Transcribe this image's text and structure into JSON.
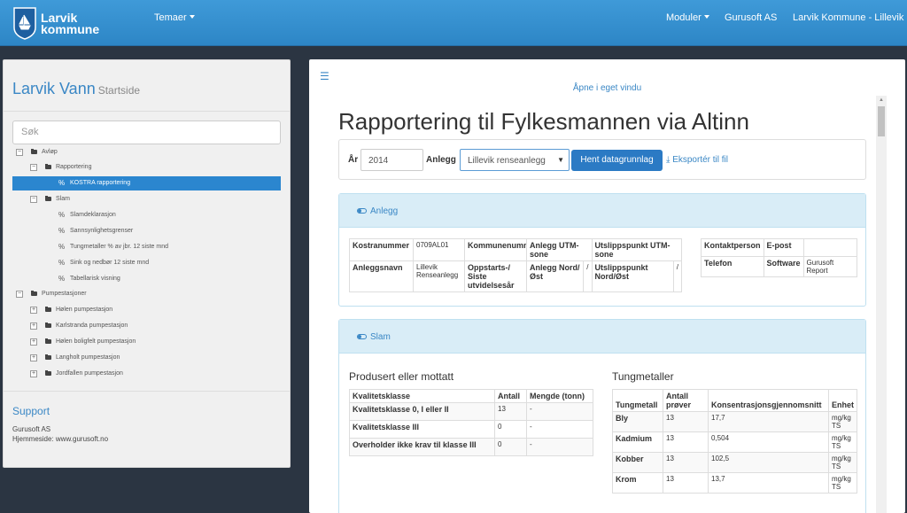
{
  "nav": {
    "logo_line1": "Larvik",
    "logo_line2": "kommune",
    "temaer": "Temaer",
    "moduler": "Moduler",
    "company": "Gurusoft AS",
    "user": "Larvik Kommune - Lillevik"
  },
  "sidebar": {
    "title": "Larvik Vann",
    "subtitle": "Startside",
    "search_placeholder": "Søk",
    "tree": [
      {
        "label": "Avløp"
      },
      {
        "label": "Rapportering"
      },
      {
        "label": "KOSTRA rapportering"
      },
      {
        "label": "Slam"
      },
      {
        "label": "Slamdeklarasjon"
      },
      {
        "label": "Sannsynlighetsgrenser"
      },
      {
        "label": "Tungmetaller % av jbr. 12 siste mnd"
      },
      {
        "label": "Sink og nedbør 12 siste mnd"
      },
      {
        "label": "Tabellarisk visning"
      },
      {
        "label": "Pumpestasjoner"
      },
      {
        "label": "Hølen pumpestasjon"
      },
      {
        "label": "Karlstranda pumpestasjon"
      },
      {
        "label": "Hølen boligfelt pumpestasjon"
      },
      {
        "label": "Langholt pumpestasjon"
      },
      {
        "label": "Jordfallen pumpestasjon"
      }
    ],
    "support_title": "Support",
    "support_company": "Gurusoft AS",
    "support_web": "Hjemmeside: www.gurusoft.no"
  },
  "main": {
    "open_window": "Åpne i eget vindu",
    "title": "Rapportering til Fylkesmannen via Altinn",
    "year_label": "År",
    "year_value": "2014",
    "plant_label": "Anlegg",
    "plant_value": "Lillevik renseanlegg",
    "fetch_button": "Hent datagrunnlag",
    "export_link": "Eksportér til fil",
    "anlegg_panel": {
      "title": "Anlegg",
      "kostranummer_label": "Kostranummer",
      "kostranummer": "0709AL01",
      "kommunenummer_label": "Kommunenummer",
      "utm_sone_label": "Anlegg UTM-sone",
      "utslipp_utm_label": "Utslippspunkt UTM-sone",
      "anleggsnavn_label": "Anleggsnavn",
      "anleggsnavn": "Lillevik Renseanlegg",
      "oppstart_label": "Oppstarts-/ Siste utvidelsesår",
      "nordost_label": "Anlegg Nord/ Øst",
      "nordost_value": "/",
      "utslipp_nordost_label": "Utslippspunkt Nord/Øst",
      "utslipp_nordost_value": "/",
      "kontakt_label": "Kontaktperson",
      "epost_label": "E-post",
      "telefon_label": "Telefon",
      "software_label": "Software",
      "software_value": "Gurusoft Report"
    },
    "slam_panel": {
      "title": "Slam",
      "produsert_title": "Produsert eller mottatt",
      "produsert_headers": [
        "Kvalitetsklasse",
        "Antall",
        "Mengde (tonn)"
      ],
      "produsert_rows": [
        [
          "Kvalitetsklasse 0, I eller II",
          "13",
          "-"
        ],
        [
          "Kvalitetsklasse III",
          "0",
          "-"
        ],
        [
          "Overholder ikke krav til klasse III",
          "0",
          "-"
        ]
      ],
      "tung_title": "Tungmetaller",
      "tung_headers": [
        "Tungmetall",
        "Antall prøver",
        "Konsentrasjonsgjennomsnitt",
        "Enhet"
      ],
      "tung_rows": [
        [
          "Bly",
          "13",
          "17,7",
          "mg/kg TS"
        ],
        [
          "Kadmium",
          "13",
          "0,504",
          "mg/kg TS"
        ],
        [
          "Kobber",
          "13",
          "102,5",
          "mg/kg TS"
        ],
        [
          "Krom",
          "13",
          "13,7",
          "mg/kg TS"
        ]
      ]
    }
  }
}
